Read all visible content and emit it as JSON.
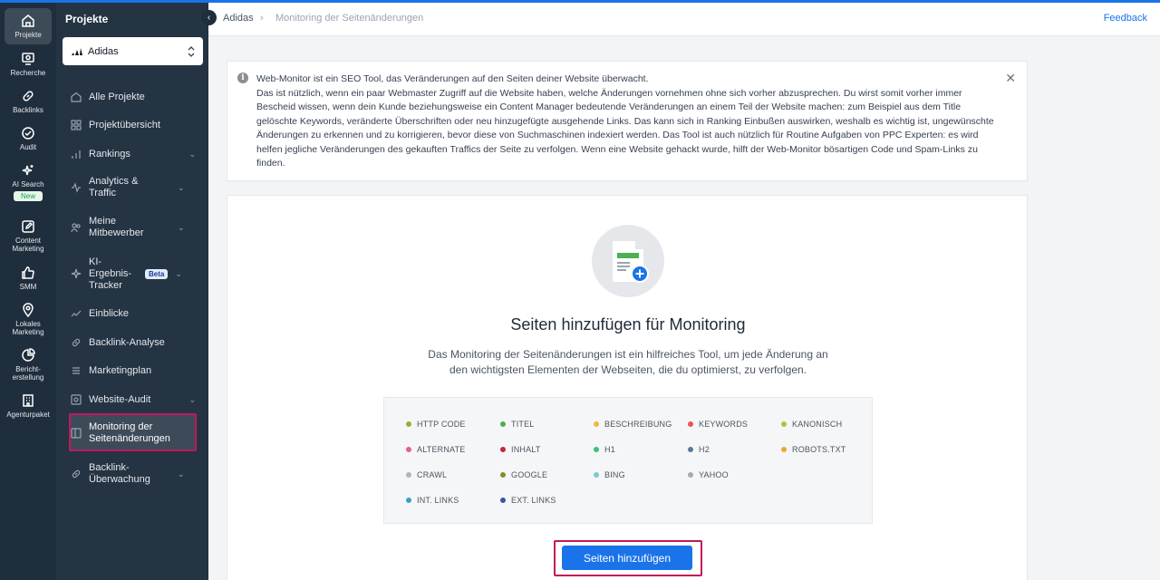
{
  "rail": {
    "items": [
      {
        "label": "Projekte",
        "icon": "home-icon"
      },
      {
        "label": "Recherche",
        "icon": "monitor-search-icon"
      },
      {
        "label": "Backlinks",
        "icon": "link-icon"
      },
      {
        "label": "Audit",
        "icon": "check-circle-icon"
      },
      {
        "label": "AI Search",
        "icon": "sparkle-icon",
        "badge": "New"
      },
      {
        "label": "Content Marketing",
        "icon": "pencil-square-icon"
      },
      {
        "label": "SMM",
        "icon": "thumbs-up-icon"
      },
      {
        "label": "Lokales Marketing",
        "icon": "map-pin-icon"
      },
      {
        "label": "Bericht-erstellung",
        "icon": "pie-chart-icon"
      },
      {
        "label": "Agenturpaket",
        "icon": "building-icon"
      }
    ]
  },
  "sidebar": {
    "title": "Projekte",
    "project": "Adidas",
    "items": [
      {
        "label": "Alle Projekte"
      },
      {
        "label": "Projektübersicht"
      },
      {
        "label": "Rankings"
      },
      {
        "label": "Analytics & Traffic"
      },
      {
        "label": "Meine Mitbewerber"
      },
      {
        "label": "KI-Ergebnis-Tracker",
        "badge": "Beta"
      },
      {
        "label": "Einblicke"
      },
      {
        "label": "Backlink-Analyse"
      },
      {
        "label": "Marketingplan"
      },
      {
        "label": "Website-Audit"
      },
      {
        "label": "Monitoring der Seitenänderungen"
      },
      {
        "label": "Backlink-Überwachung"
      }
    ]
  },
  "breadcrumb": {
    "project": "Adidas",
    "separator": "›",
    "current": "Monitoring der Seitenänderungen"
  },
  "feedback": "Feedback",
  "info": {
    "lines": [
      "Web-Monitor ist ein SEO Tool, das Veränderungen auf den Seiten deiner Website überwacht.",
      "Das ist nützlich, wenn ein paar Webmaster Zugriff auf die Website haben, welche Änderungen vornehmen ohne sich vorher abzusprechen. Du wirst somit vorher immer Bescheid wissen, wenn dein Kunde beziehungsweise ein Content Manager bedeutende Veränderungen an einem Teil der Website machen: zum Beispiel aus dem Title gelöschte Keywords, veränderte Überschriften oder neu hinzugefügte ausgehende Links. Das kann sich in Ranking Einbußen auswirken, weshalb es wichtig ist, ungewünschte Änderungen zu erkennen und zu korrigieren, bevor diese von Suchmaschinen indexiert werden. Das Tool ist auch nützlich für Routine Aufgaben von PPC Experten: es wird helfen jegliche Veränderungen des gekauften Traffics der Seite zu verfolgen. Wenn eine Website gehackt wurde, hilft der Web-Monitor bösartigen Code und Spam-Links zu finden."
    ]
  },
  "main": {
    "title": "Seiten hinzufügen für Monitoring",
    "description": "Das Monitoring der Seitenänderungen ist ein hilfreiches Tool, um jede Änderung an den wichtigsten Elementen der Webseiten, die du optimierst, zu verfolgen.",
    "tags": [
      {
        "label": "HTTP CODE",
        "color": "#8fb339"
      },
      {
        "label": "TITEL",
        "color": "#4caf50"
      },
      {
        "label": "BESCHREIBUNG",
        "color": "#f4b63f"
      },
      {
        "label": "KEYWORDS",
        "color": "#ef5350"
      },
      {
        "label": "KANONISCH",
        "color": "#9ccc3c"
      },
      {
        "label": "ALTERNATE",
        "color": "#e0609a"
      },
      {
        "label": "INHALT",
        "color": "#c62839"
      },
      {
        "label": "H1",
        "color": "#3dbf7f"
      },
      {
        "label": "H2",
        "color": "#5c7a9c"
      },
      {
        "label": "ROBOTS.TXT",
        "color": "#f2a33a"
      },
      {
        "label": "CRAWL",
        "color": "#b0b5ba"
      },
      {
        "label": "GOOGLE",
        "color": "#8b8a2c"
      },
      {
        "label": "BING",
        "color": "#7ec9d1"
      },
      {
        "label": "YAHOO",
        "color": "#a7a9ab"
      },
      {
        "label": "INT. LINKS",
        "color": "#3a9fc2"
      },
      {
        "label": "EXT. LINKS",
        "color": "#2f5aa8"
      }
    ],
    "button": "Seiten hinzufügen"
  },
  "colors": {
    "accent": "#1a73e8",
    "highlight": "#c2185b",
    "sidebar": "#243443",
    "rail": "#1f2e3d"
  }
}
